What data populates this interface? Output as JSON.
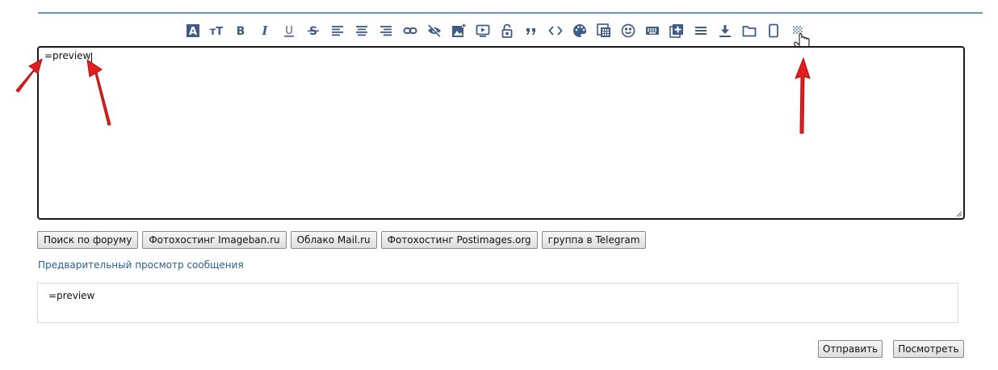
{
  "toolbar": {
    "items": [
      {
        "name": "font-color-icon",
        "glyph": "A",
        "style": "box"
      },
      {
        "name": "font-size-icon",
        "glyph": "тT"
      },
      {
        "name": "bold-icon",
        "glyph": "B"
      },
      {
        "name": "italic-icon",
        "glyph": "I"
      },
      {
        "name": "underline-icon",
        "glyph": "U"
      },
      {
        "name": "strikethrough-icon",
        "glyph": "S"
      },
      {
        "name": "align-left-icon"
      },
      {
        "name": "align-center-icon"
      },
      {
        "name": "align-right-icon"
      },
      {
        "name": "link-icon"
      },
      {
        "name": "hide-icon"
      },
      {
        "name": "image-icon"
      },
      {
        "name": "video-icon"
      },
      {
        "name": "lock-icon"
      },
      {
        "name": "quote-icon",
        "glyph": "”"
      },
      {
        "name": "code-icon",
        "glyph": "<>"
      },
      {
        "name": "palette-icon"
      },
      {
        "name": "calculator-icon"
      },
      {
        "name": "smiley-icon"
      },
      {
        "name": "keyboard-icon"
      },
      {
        "name": "add-box-icon"
      },
      {
        "name": "menu-icon"
      },
      {
        "name": "download-icon"
      },
      {
        "name": "folder-icon"
      },
      {
        "name": "mobile-icon"
      },
      {
        "name": "preview-grid-icon"
      }
    ]
  },
  "editor": {
    "value": "=preview"
  },
  "buttons": {
    "search": "Поиск по форуму",
    "imageban": "Фотохостинг Imageban.ru",
    "mail_cloud": "Облако Mail.ru",
    "postimages": "Фотохостинг Postimages.org",
    "telegram": "группа в Telegram"
  },
  "preview": {
    "label": "Предварительный просмотр сообщения",
    "content": "=preview"
  },
  "actions": {
    "submit": "Отправить",
    "view": "Посмотреть"
  },
  "colors": {
    "icon": "#3d5c86",
    "accent_line": "#6b93c3",
    "link": "#2a5d94",
    "annotation_arrow": "#e02020"
  }
}
